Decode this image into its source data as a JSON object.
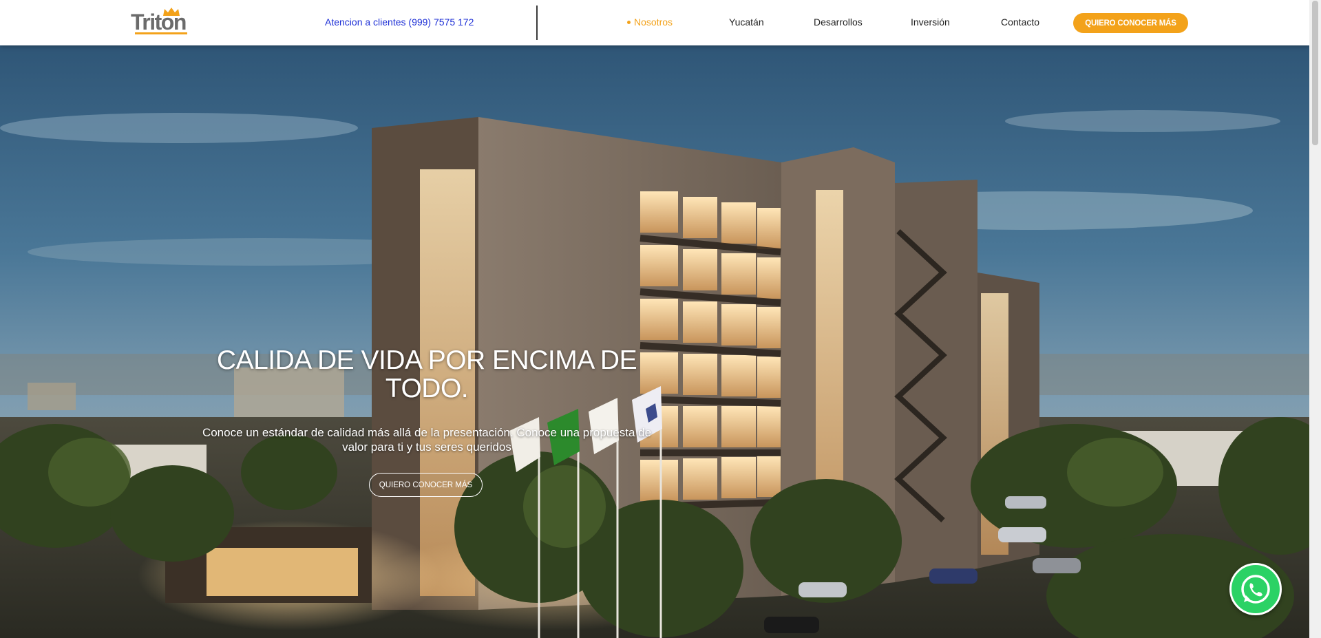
{
  "header": {
    "logo_text": "Triton",
    "phone_label": "Atencion a clientes (999) 7575 172",
    "nav": [
      {
        "label": "Nosotros",
        "active": true
      },
      {
        "label": "Yucatán",
        "active": false
      },
      {
        "label": "Desarrollos",
        "active": false
      },
      {
        "label": "Inversión",
        "active": false
      },
      {
        "label": "Contacto",
        "active": false
      }
    ],
    "cta_label": "QUIERO CONOCER MÁS"
  },
  "hero": {
    "title": "CALIDA DE VIDA POR ENCIMA DE TODO.",
    "subtitle": "Conoce un estándar de calidad más allá de la presentación. Conoce una propuesta de valor para ti y tus seres queridos",
    "button_label": "QUIERO CONOCER MÁS"
  },
  "icons": {
    "whatsapp": "whatsapp-icon",
    "logo_crown": "crown-icon"
  },
  "colors": {
    "accent": "#f3a21a",
    "phone_link": "#1d2fd6",
    "whatsapp": "#2bd265"
  }
}
